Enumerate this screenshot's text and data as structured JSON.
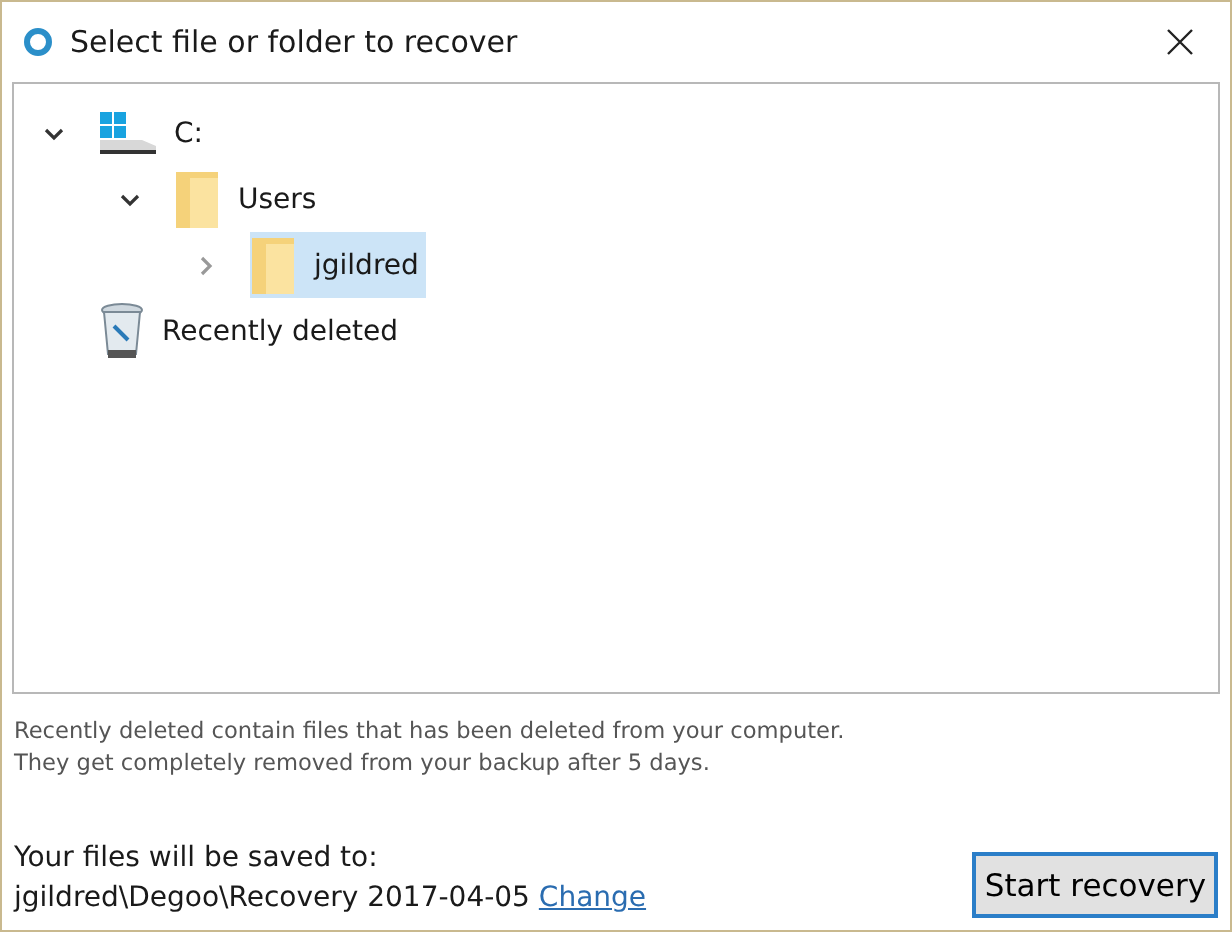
{
  "window": {
    "title": "Select file or folder to recover"
  },
  "tree": [
    {
      "label": "C:",
      "kind": "drive",
      "expanded": true,
      "selected": false,
      "children": [
        {
          "label": "Users",
          "kind": "folder",
          "expanded": true,
          "selected": false,
          "children": [
            {
              "label": "jgildred",
              "kind": "folder",
              "expanded": false,
              "selected": true
            }
          ]
        }
      ]
    },
    {
      "label": "Recently deleted",
      "kind": "trash",
      "selected": false
    }
  ],
  "note": [
    "Recently deleted contain files that has been deleted from your computer.",
    "They get completely removed from your backup after 5 days."
  ],
  "destination": {
    "label": "Your files will be saved to:",
    "path": "jgildred\\Degoo\\Recovery 2017-04-05",
    "link": "Change"
  },
  "buttons": [
    "Start recovery"
  ]
}
